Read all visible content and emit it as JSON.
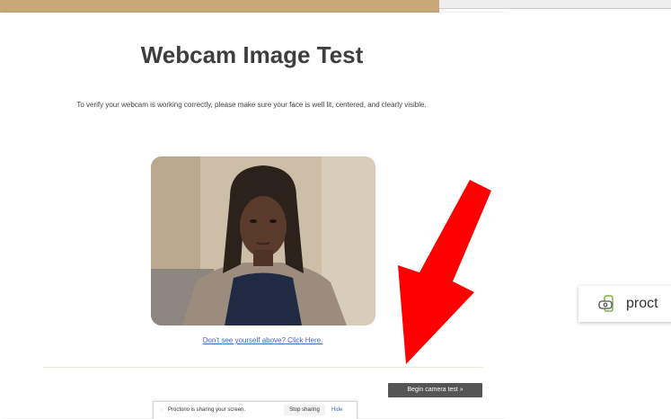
{
  "page": {
    "title": "Webcam Image Test",
    "description": "To verify your webcam is working correctly, please make sure your face is well lit, centered, and clearly visible.",
    "help_link": "Don't see yourself above? Click Here.",
    "begin_button": "Begin camera test »"
  },
  "share_bar": {
    "grip": "⁙",
    "message": "Proctorio is sharing your screen.",
    "stop_label": "Stop sharing",
    "hide_label": "Hide"
  },
  "badge": {
    "text": "proct"
  },
  "colors": {
    "accent_tan": "#c9a877",
    "arrow_red": "#ff0000",
    "link_blue": "#3a6fb0",
    "button_dark": "#555555"
  },
  "icons": [
    "webcam-image",
    "red-arrow-icon",
    "proctorio-logo-icon"
  ]
}
